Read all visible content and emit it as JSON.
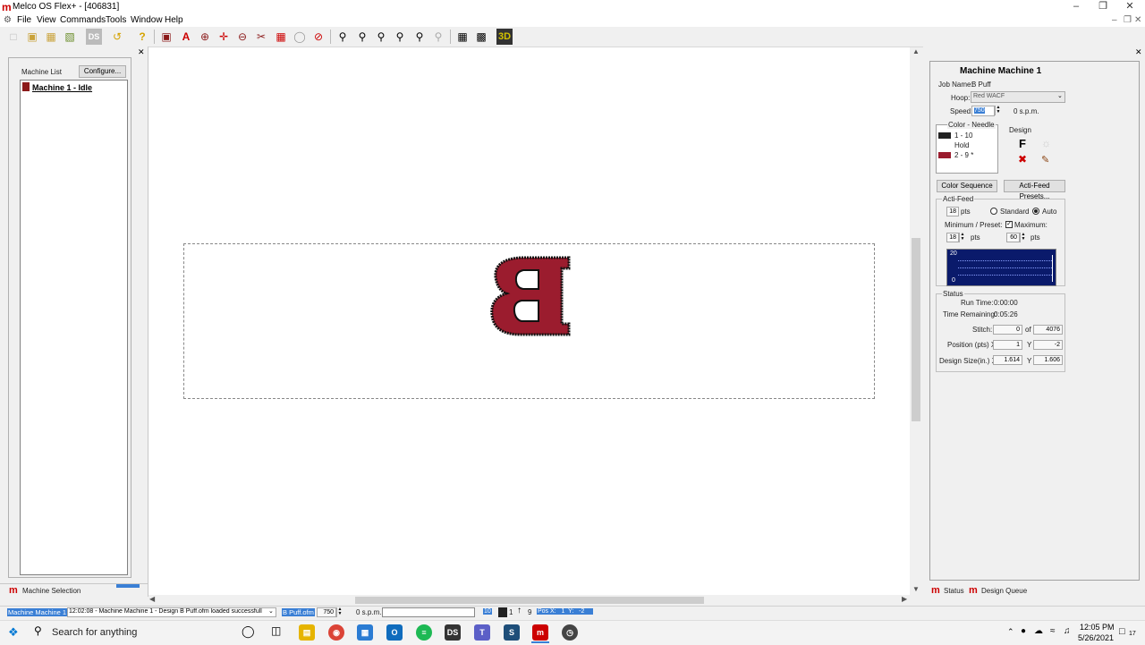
{
  "window": {
    "title": "Melco OS Flex+ - [406831]",
    "logo": "m"
  },
  "menu": [
    "File",
    "View",
    "Commands",
    "Tools",
    "Window",
    "Help"
  ],
  "left_panel": {
    "header": "Machine List",
    "configure_label": "Configure...",
    "machine_item": "Machine 1 - Idle",
    "tab_label": "Machine Selection"
  },
  "canvas": {
    "design_letter": "B",
    "design_color": "#9b1c2e"
  },
  "right_panel": {
    "heading": "Machine Machine 1",
    "job_name_label": "Job Name:",
    "job_name_value": "B Puff",
    "hoop_label": "Hoop:",
    "hoop_value": "Red WACF",
    "speed_label": "Speed:",
    "speed_value": "750",
    "speed_unit": "0 s.p.m.",
    "color_needle_label": "Color - Needle",
    "color_rows": [
      {
        "text": "1  -  10",
        "color": "#222222"
      },
      {
        "text": "Hold",
        "color": ""
      },
      {
        "text": "2  -  9  *",
        "color": "#9b1c2e"
      }
    ],
    "design_label": "Design",
    "color_sequence_label": "Color Sequence",
    "actifeed_presets_label": "Acti-Feed Presets...",
    "actifeed_label": "Acti-Feed",
    "actifeed_value": "18",
    "pts": "pts",
    "standard_label": "Standard",
    "auto_label": "Auto",
    "minimum_label": "Minimum / Preset:",
    "maximum_label": "Maximum:",
    "min_value": "18",
    "max_value": "60",
    "graph_top": "20",
    "graph_bottom": "0",
    "status_label": "Status",
    "run_time_label": "Run Time:",
    "run_time_value": "0:00:00",
    "time_remaining_label": "Time Remaining:",
    "time_remaining_value": "0:05:26",
    "stitch_label": "Stitch:",
    "stitch_value": "0",
    "of_label": "of",
    "stitch_total": "4076",
    "position_label": "Position (pts) X",
    "pos_x": "1",
    "y_label": "Y",
    "pos_y": "-2",
    "design_size_label": "Design Size(in.) X",
    "size_x": "1.614",
    "size_y": "1.606",
    "tab_status": "Status",
    "tab_design_queue": "Design Queue"
  },
  "status_bar": {
    "machine": "Machine Machine 1",
    "message": "12:02:08 - Machine Machine 1 - Design B Puff.ofm loaded successfull",
    "file": "B Puff.ofm",
    "speed": "750",
    "spm": "0 s.p.m.",
    "needle": "10",
    "color_index": "1",
    "color_count": "9",
    "pos": "Pos X:   1  Y:   -2"
  },
  "taskbar": {
    "search_placeholder": "Search for anything",
    "time": "12:05 PM",
    "date": "5/26/2021",
    "notification_count": "17"
  }
}
